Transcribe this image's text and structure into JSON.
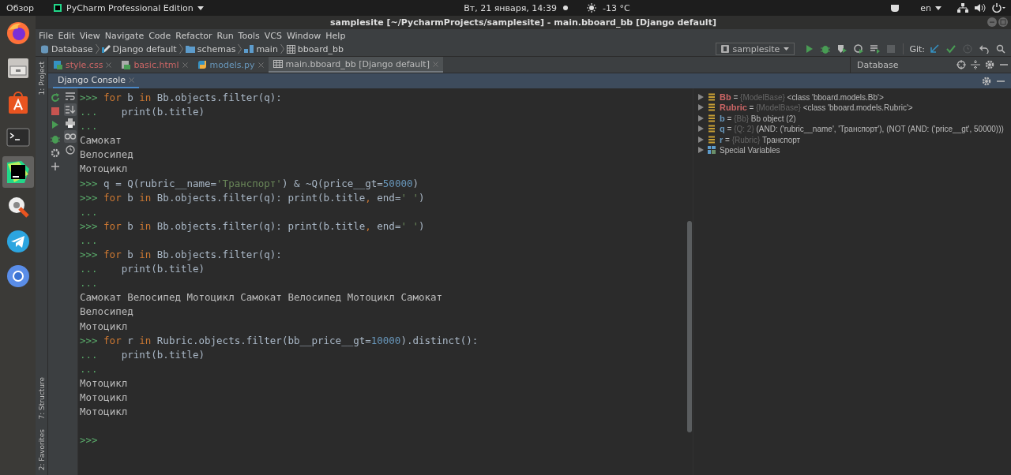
{
  "topbar": {
    "activities": "Обзор",
    "app_menu": "PyCharm Professional Edition",
    "clock": "Вт, 21 января, 14:39",
    "weather": "-13 °C",
    "keyboard": "en"
  },
  "dock": {
    "items": [
      {
        "kind": "firefox",
        "selected": false
      },
      {
        "kind": "files",
        "selected": false
      },
      {
        "kind": "software",
        "selected": false
      },
      {
        "kind": "terminal",
        "selected": false
      },
      {
        "kind": "pycharm",
        "selected": true
      },
      {
        "kind": "settings",
        "selected": false
      },
      {
        "kind": "telegram",
        "selected": false
      },
      {
        "kind": "chromium",
        "selected": false
      }
    ]
  },
  "window": {
    "title": "samplesite [~/PycharmProjects/samplesite] - main.bboard_bb [Django default]"
  },
  "menu": [
    "File",
    "Edit",
    "View",
    "Navigate",
    "Code",
    "Refactor",
    "Run",
    "Tools",
    "VCS",
    "Window",
    "Help"
  ],
  "breadcrumbs": [
    {
      "kind": "database",
      "label": "Database"
    },
    {
      "kind": "datasource",
      "label": "Django default"
    },
    {
      "kind": "folder",
      "label": "schemas"
    },
    {
      "kind": "schema",
      "label": "main"
    },
    {
      "kind": "table",
      "label": "bboard_bb"
    }
  ],
  "run_config": "samplesite",
  "git_label": "Git:",
  "side_tools": {
    "top": "1: Project",
    "bottom": [
      "7: Structure",
      "2: Favorites"
    ]
  },
  "editor_tabs": [
    {
      "label": "style.css",
      "color": "#cc6666",
      "kind": "css",
      "selected": false
    },
    {
      "label": "basic.html",
      "color": "#cc6666",
      "kind": "html",
      "selected": false
    },
    {
      "label": "models.py",
      "color": "#6897bb",
      "kind": "python",
      "selected": false
    },
    {
      "label": "main.bboard_bb [Django default]",
      "color": "#bbbbbb",
      "kind": "table",
      "selected": true
    }
  ],
  "database_panel": {
    "title": "Database"
  },
  "console_tabs": [
    {
      "label": "Django Console",
      "selected": true
    }
  ],
  "console": {
    "lines": [
      {
        "kind": "input",
        "prompt": ">>>",
        "tokens": [
          {
            "kind": "kw",
            "text": "for"
          },
          {
            "kind": "plain",
            "text": " b "
          },
          {
            "kind": "kw",
            "text": "in"
          },
          {
            "kind": "plain",
            "text": " Bb.objects.filter(q):"
          }
        ]
      },
      {
        "kind": "input",
        "prompt": "...",
        "tokens": [
          {
            "kind": "plain",
            "text": "   print(b.title)"
          }
        ]
      },
      {
        "kind": "input",
        "prompt": "..."
      },
      {
        "kind": "output",
        "text": "Самокат"
      },
      {
        "kind": "output",
        "text": "Велосипед"
      },
      {
        "kind": "output",
        "text": "Мотоцикл"
      },
      {
        "kind": "input",
        "prompt": ">>>",
        "tokens": [
          {
            "kind": "plain",
            "text": "q = Q(rubric__name="
          },
          {
            "kind": "str",
            "text": "'Транспорт'"
          },
          {
            "kind": "plain",
            "text": ") & ~Q(price__gt="
          },
          {
            "kind": "num",
            "text": "50000"
          },
          {
            "kind": "plain",
            "text": ")"
          }
        ]
      },
      {
        "kind": "input",
        "prompt": ">>>",
        "tokens": [
          {
            "kind": "kw",
            "text": "for"
          },
          {
            "kind": "plain",
            "text": " b "
          },
          {
            "kind": "kw",
            "text": "in"
          },
          {
            "kind": "plain",
            "text": " Bb.objects.filter(q): print(b.title"
          },
          {
            "kind": "kw",
            "text": ","
          },
          {
            "kind": "plain",
            "text": " end="
          },
          {
            "kind": "str",
            "text": "' '"
          },
          {
            "kind": "plain",
            "text": ")"
          }
        ]
      },
      {
        "kind": "input",
        "prompt": "..."
      },
      {
        "kind": "input",
        "prompt": ">>>",
        "tokens": [
          {
            "kind": "kw",
            "text": "for"
          },
          {
            "kind": "plain",
            "text": " b "
          },
          {
            "kind": "kw",
            "text": "in"
          },
          {
            "kind": "plain",
            "text": " Bb.objects.filter(q): print(b.title"
          },
          {
            "kind": "kw",
            "text": ","
          },
          {
            "kind": "plain",
            "text": " end="
          },
          {
            "kind": "str",
            "text": "' '"
          },
          {
            "kind": "plain",
            "text": ")"
          }
        ]
      },
      {
        "kind": "input",
        "prompt": "..."
      },
      {
        "kind": "input",
        "prompt": ">>>",
        "tokens": [
          {
            "kind": "kw",
            "text": "for"
          },
          {
            "kind": "plain",
            "text": " b "
          },
          {
            "kind": "kw",
            "text": "in"
          },
          {
            "kind": "plain",
            "text": " Bb.objects.filter(q):"
          }
        ]
      },
      {
        "kind": "input",
        "prompt": "...",
        "tokens": [
          {
            "kind": "plain",
            "text": "   print(b.title)"
          }
        ]
      },
      {
        "kind": "input",
        "prompt": "..."
      },
      {
        "kind": "output",
        "text": "Самокат Велосипед Мотоцикл Самокат Велосипед Мотоцикл Самокат"
      },
      {
        "kind": "output",
        "text": "Велосипед"
      },
      {
        "kind": "output",
        "text": "Мотоцикл"
      },
      {
        "kind": "input",
        "prompt": ">>>",
        "tokens": [
          {
            "kind": "kw",
            "text": "for"
          },
          {
            "kind": "plain",
            "text": " r "
          },
          {
            "kind": "kw",
            "text": "in"
          },
          {
            "kind": "plain",
            "text": " Rubric.objects.filter(bb__price__gt="
          },
          {
            "kind": "num",
            "text": "10000"
          },
          {
            "kind": "plain",
            "text": ").distinct():"
          }
        ]
      },
      {
        "kind": "input",
        "prompt": "...",
        "tokens": [
          {
            "kind": "plain",
            "text": "   print(b.title)"
          }
        ]
      },
      {
        "kind": "input",
        "prompt": "..."
      },
      {
        "kind": "output",
        "text": "Мотоцикл"
      },
      {
        "kind": "output",
        "text": "Мотоцикл"
      },
      {
        "kind": "output",
        "text": "Мотоцикл"
      },
      {
        "kind": "blank"
      },
      {
        "kind": "input",
        "prompt": ">>>"
      }
    ]
  },
  "variables": [
    {
      "kind": "var",
      "name": "Bb",
      "color": "#cc6666",
      "separator": "=",
      "type": "{ModelBase}",
      "value": "<class 'bboard.models.Bb'>"
    },
    {
      "kind": "var",
      "name": "Rubric",
      "color": "#cc6666",
      "separator": "=",
      "type": "{ModelBase}",
      "value": "<class 'bboard.models.Rubric'>"
    },
    {
      "kind": "var",
      "name": "b",
      "color": "#6897bb",
      "separator": "=",
      "type": "{Bb}",
      "value": "Bb object (2)"
    },
    {
      "kind": "var",
      "name": "q",
      "color": "#6897bb",
      "separator": "=",
      "type": "{Q: 2}",
      "value": "(AND: ('rubric__name', 'Транспорт'), (NOT (AND: ('price__gt', 50000)))"
    },
    {
      "kind": "var",
      "name": "r",
      "color": "#6897bb",
      "separator": "=",
      "type": "{Rubric}",
      "value": "Транспорт"
    },
    {
      "kind": "special",
      "name": "Special Variables"
    }
  ]
}
